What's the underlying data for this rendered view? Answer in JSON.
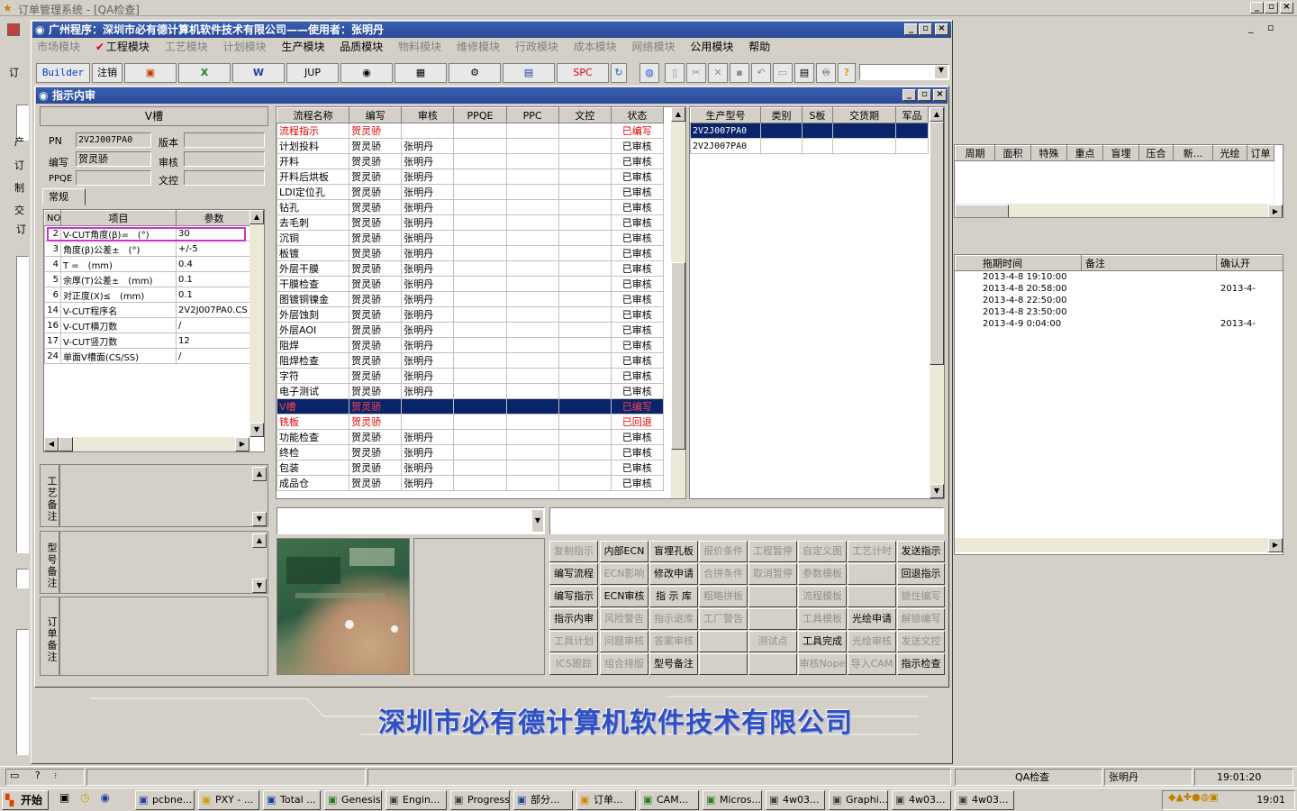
{
  "outer": {
    "title": "订单管理系统 - [QA检查]"
  },
  "app": {
    "title": "广州程序：深圳市必有德计算机软件技术有限公司——使用者：张明丹"
  },
  "menu": [
    "市场模块",
    "工程模块",
    "工艺模块",
    "计划模块",
    "生产模块",
    "品质模块",
    "物料模块",
    "维修模块",
    "行政模块",
    "成本模块",
    "网络模块",
    "公用模块",
    "帮助"
  ],
  "toolbar": {
    "builder": "Builder",
    "logout": "注销",
    "jup": "JUP",
    "spc": "SPC"
  },
  "inner": {
    "title": "指示内审"
  },
  "left": {
    "header": "V槽",
    "pn_label": "PN",
    "pn": "2V2J007PA0",
    "ver_label": "版本",
    "ver": "",
    "bx_label": "编写",
    "bx": "贺灵骄",
    "sh_label": "审核",
    "sh": "",
    "ppqe_label": "PPQE",
    "ppqe": "",
    "wk_label": "文控",
    "wk": "",
    "tab": "常规",
    "cols": [
      "NO",
      "项目",
      "参数"
    ],
    "rows": [
      [
        "2",
        "V-CUT角度(β)=　(°)",
        "30"
      ],
      [
        "3",
        "角度(β)公差±　(°)",
        "+/-5"
      ],
      [
        "4",
        "T =　(mm)",
        "0.4"
      ],
      [
        "5",
        "余厚(T)公差±　(mm)",
        "0.1"
      ],
      [
        "6",
        "对正度(X)≤　(mm)",
        "0.1"
      ],
      [
        "14",
        "V-CUT程序名",
        "2V2J007PA0.CS"
      ],
      [
        "16",
        "V-CUT横刀数",
        "/"
      ],
      [
        "17",
        "V-CUT竖刀数",
        "12"
      ],
      [
        "24",
        "单面V槽面(CS/SS)",
        "/"
      ]
    ],
    "notes": [
      "工艺备注",
      "型号备注",
      "订单备注"
    ]
  },
  "flow": {
    "cols": [
      "流程名称",
      "编写",
      "审核",
      "PPQE",
      "PPC",
      "文控",
      "状态"
    ],
    "rows": [
      [
        "流程指示",
        "贺灵骄",
        "",
        "",
        "",
        "",
        "已编写",
        "red"
      ],
      [
        "计划投料",
        "贺灵骄",
        "张明丹",
        "",
        "",
        "",
        "已审核",
        ""
      ],
      [
        "开料",
        "贺灵骄",
        "张明丹",
        "",
        "",
        "",
        "已审核",
        ""
      ],
      [
        "开料后烘板",
        "贺灵骄",
        "张明丹",
        "",
        "",
        "",
        "已审核",
        ""
      ],
      [
        "LDI定位孔",
        "贺灵骄",
        "张明丹",
        "",
        "",
        "",
        "已审核",
        ""
      ],
      [
        "钻孔",
        "贺灵骄",
        "张明丹",
        "",
        "",
        "",
        "已审核",
        ""
      ],
      [
        "去毛刺",
        "贺灵骄",
        "张明丹",
        "",
        "",
        "",
        "已审核",
        ""
      ],
      [
        "沉铜",
        "贺灵骄",
        "张明丹",
        "",
        "",
        "",
        "已审核",
        ""
      ],
      [
        "板镀",
        "贺灵骄",
        "张明丹",
        "",
        "",
        "",
        "已审核",
        ""
      ],
      [
        "外层干膜",
        "贺灵骄",
        "张明丹",
        "",
        "",
        "",
        "已审核",
        ""
      ],
      [
        "干膜检查",
        "贺灵骄",
        "张明丹",
        "",
        "",
        "",
        "已审核",
        ""
      ],
      [
        "图镀铜镍金",
        "贺灵骄",
        "张明丹",
        "",
        "",
        "",
        "已审核",
        ""
      ],
      [
        "外层蚀刻",
        "贺灵骄",
        "张明丹",
        "",
        "",
        "",
        "已审核",
        ""
      ],
      [
        "外层AOI",
        "贺灵骄",
        "张明丹",
        "",
        "",
        "",
        "已审核",
        ""
      ],
      [
        "阻焊",
        "贺灵骄",
        "张明丹",
        "",
        "",
        "",
        "已审核",
        ""
      ],
      [
        "阻焊检查",
        "贺灵骄",
        "张明丹",
        "",
        "",
        "",
        "已审核",
        ""
      ],
      [
        "字符",
        "贺灵骄",
        "张明丹",
        "",
        "",
        "",
        "已审核",
        ""
      ],
      [
        "电子测试",
        "贺灵骄",
        "张明丹",
        "",
        "",
        "",
        "已审核",
        ""
      ],
      [
        "V槽",
        "贺灵骄",
        "",
        "",
        "",
        "",
        "已编写",
        "sel"
      ],
      [
        "铣板",
        "贺灵骄",
        "",
        "",
        "",
        "",
        "已回退",
        "red"
      ],
      [
        "功能检查",
        "贺灵骄",
        "张明丹",
        "",
        "",
        "",
        "已审核",
        ""
      ],
      [
        "终检",
        "贺灵骄",
        "张明丹",
        "",
        "",
        "",
        "已审核",
        ""
      ],
      [
        "包装",
        "贺灵骄",
        "张明丹",
        "",
        "",
        "",
        "已审核",
        ""
      ],
      [
        "成品仓",
        "贺灵骄",
        "张明丹",
        "",
        "",
        "",
        "已审核",
        ""
      ]
    ]
  },
  "prod": {
    "cols": [
      "生产型号",
      "类别",
      "S板",
      "交货期",
      "军品"
    ],
    "rows": [
      "2V2J007PA0",
      "2V2J007PA0"
    ]
  },
  "buttons": [
    [
      "复制指示",
      "内部ECN",
      "盲埋孔板",
      "报价条件",
      "工程暂停",
      "自定义图",
      "工艺计时",
      "发送指示"
    ],
    [
      "编写流程",
      "ECN影响",
      "修改申请",
      "合拼条件",
      "取消暂停",
      "参数模板",
      "",
      "回退指示"
    ],
    [
      "编写指示",
      "ECN审核",
      "指 示 库",
      "粗略拼板",
      "",
      "流程模板",
      "",
      "锁住编写"
    ],
    [
      "指示内审",
      "风险警告",
      "指示退库",
      "工厂警告",
      "",
      "工具模板",
      "光绘申请",
      "解锁编写"
    ],
    [
      "工具计划",
      "问题审核",
      "答案审核",
      "",
      "测试点",
      "工具完成",
      "光绘审核",
      "发送文控"
    ],
    [
      "ICS跟踪",
      "组合排版",
      "型号备注",
      "",
      "",
      "审核Nope",
      "导入CAM",
      "指示检查"
    ]
  ],
  "btn_enabled": [
    [
      0,
      1,
      1,
      0,
      0,
      0,
      0,
      1
    ],
    [
      1,
      0,
      1,
      0,
      0,
      0,
      0,
      1
    ],
    [
      1,
      1,
      1,
      0,
      0,
      0,
      0,
      0
    ],
    [
      1,
      0,
      0,
      0,
      0,
      0,
      1,
      0
    ],
    [
      0,
      0,
      0,
      0,
      0,
      1,
      0,
      0
    ],
    [
      0,
      0,
      1,
      0,
      0,
      0,
      0,
      1
    ]
  ],
  "banner": "深圳市必有德计算机软件技术有限公司",
  "right": {
    "cols1": [
      "周期",
      "面积",
      "特殊",
      "重点",
      "盲埋",
      "压合",
      "新...",
      "光绘",
      "订单"
    ],
    "cols2": [
      "拖期时间",
      "备注",
      "确认开"
    ],
    "rows2": [
      [
        "2013-4-8 19:10:00",
        "",
        ""
      ],
      [
        "2013-4-8 20:58:00",
        "",
        "2013-4-"
      ],
      [
        "2013-4-8 22:50:00",
        "",
        ""
      ],
      [
        "2013-4-8 23:50:00",
        "",
        ""
      ],
      [
        "2013-4-9 0:04:00",
        "",
        "2013-4-"
      ]
    ]
  },
  "status": {
    "module": "QA检查",
    "user": "张明丹",
    "time": "19:01:20"
  },
  "taskbar": {
    "start": "开始",
    "items": [
      "pcbne...",
      "PXY - ...",
      "Total ...",
      "Genesis",
      "Engin...",
      "Progress",
      "部分...",
      "订单...",
      "CAM...",
      "Micros...",
      "4w03...",
      "Graphi...",
      "4w03...",
      "4w03..."
    ],
    "clock": "19:01"
  },
  "left_strip": [
    "订",
    "产",
    "订",
    "制",
    "交",
    "订"
  ]
}
